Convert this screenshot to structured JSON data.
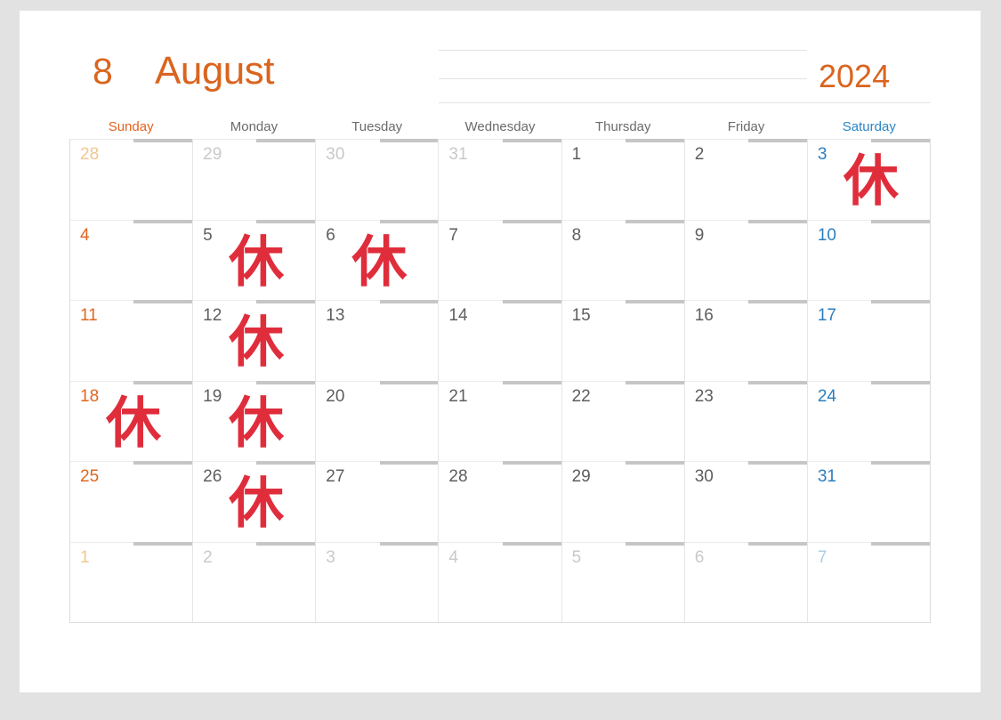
{
  "header": {
    "month_number": "8",
    "month_name": "August",
    "year": "2024"
  },
  "weekdays": [
    {
      "label": "Sunday",
      "kind": "sun"
    },
    {
      "label": "Monday",
      "kind": "wd"
    },
    {
      "label": "Tuesday",
      "kind": "wd"
    },
    {
      "label": "Wednesday",
      "kind": "wd"
    },
    {
      "label": "Thursday",
      "kind": "wd"
    },
    {
      "label": "Friday",
      "kind": "wd"
    },
    {
      "label": "Saturday",
      "kind": "sat"
    }
  ],
  "colors": {
    "accent_orange": "#d9651f",
    "saturday_blue": "#2a7fc0",
    "holiday_red": "#e02d3c",
    "grid_line": "#e6e6e6",
    "tick_gray": "#c6c6c6",
    "page_background": "#e2e2e2",
    "card_background": "#ffffff"
  },
  "holiday_label": "休",
  "weeks": [
    [
      {
        "date": "28",
        "out": true,
        "kind": "sun",
        "holiday": false
      },
      {
        "date": "29",
        "out": true,
        "kind": "wd",
        "holiday": false
      },
      {
        "date": "30",
        "out": true,
        "kind": "wd",
        "holiday": false
      },
      {
        "date": "31",
        "out": true,
        "kind": "wd",
        "holiday": false
      },
      {
        "date": "1",
        "out": false,
        "kind": "wd",
        "holiday": false
      },
      {
        "date": "2",
        "out": false,
        "kind": "wd",
        "holiday": false
      },
      {
        "date": "3",
        "out": false,
        "kind": "sat",
        "holiday": true
      }
    ],
    [
      {
        "date": "4",
        "out": false,
        "kind": "sun",
        "holiday": false
      },
      {
        "date": "5",
        "out": false,
        "kind": "wd",
        "holiday": true
      },
      {
        "date": "6",
        "out": false,
        "kind": "wd",
        "holiday": true
      },
      {
        "date": "7",
        "out": false,
        "kind": "wd",
        "holiday": false
      },
      {
        "date": "8",
        "out": false,
        "kind": "wd",
        "holiday": false
      },
      {
        "date": "9",
        "out": false,
        "kind": "wd",
        "holiday": false
      },
      {
        "date": "10",
        "out": false,
        "kind": "sat",
        "holiday": false
      }
    ],
    [
      {
        "date": "11",
        "out": false,
        "kind": "sun",
        "holiday": false
      },
      {
        "date": "12",
        "out": false,
        "kind": "wd",
        "holiday": true
      },
      {
        "date": "13",
        "out": false,
        "kind": "wd",
        "holiday": false
      },
      {
        "date": "14",
        "out": false,
        "kind": "wd",
        "holiday": false
      },
      {
        "date": "15",
        "out": false,
        "kind": "wd",
        "holiday": false
      },
      {
        "date": "16",
        "out": false,
        "kind": "wd",
        "holiday": false
      },
      {
        "date": "17",
        "out": false,
        "kind": "sat",
        "holiday": false
      }
    ],
    [
      {
        "date": "18",
        "out": false,
        "kind": "sun",
        "holiday": true
      },
      {
        "date": "19",
        "out": false,
        "kind": "wd",
        "holiday": true
      },
      {
        "date": "20",
        "out": false,
        "kind": "wd",
        "holiday": false
      },
      {
        "date": "21",
        "out": false,
        "kind": "wd",
        "holiday": false
      },
      {
        "date": "22",
        "out": false,
        "kind": "wd",
        "holiday": false
      },
      {
        "date": "23",
        "out": false,
        "kind": "wd",
        "holiday": false
      },
      {
        "date": "24",
        "out": false,
        "kind": "sat",
        "holiday": false
      }
    ],
    [
      {
        "date": "25",
        "out": false,
        "kind": "sun",
        "holiday": false
      },
      {
        "date": "26",
        "out": false,
        "kind": "wd",
        "holiday": true
      },
      {
        "date": "27",
        "out": false,
        "kind": "wd",
        "holiday": false
      },
      {
        "date": "28",
        "out": false,
        "kind": "wd",
        "holiday": false
      },
      {
        "date": "29",
        "out": false,
        "kind": "wd",
        "holiday": false
      },
      {
        "date": "30",
        "out": false,
        "kind": "wd",
        "holiday": false
      },
      {
        "date": "31",
        "out": false,
        "kind": "sat",
        "holiday": false
      }
    ],
    [
      {
        "date": "1",
        "out": true,
        "kind": "sun",
        "holiday": false
      },
      {
        "date": "2",
        "out": true,
        "kind": "wd",
        "holiday": false
      },
      {
        "date": "3",
        "out": true,
        "kind": "wd",
        "holiday": false
      },
      {
        "date": "4",
        "out": true,
        "kind": "wd",
        "holiday": false
      },
      {
        "date": "5",
        "out": true,
        "kind": "wd",
        "holiday": false
      },
      {
        "date": "6",
        "out": true,
        "kind": "wd",
        "holiday": false
      },
      {
        "date": "7",
        "out": true,
        "kind": "sat",
        "holiday": false
      }
    ]
  ]
}
